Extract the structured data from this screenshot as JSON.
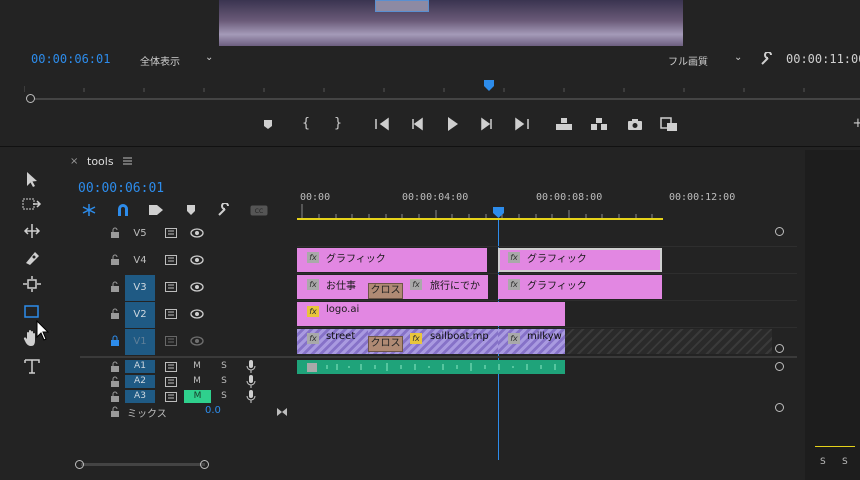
{
  "program_monitor": {
    "current_timecode": "00:00:06:01",
    "zoom_select": "全体表示",
    "quality_select": "フル画質",
    "duration_timecode": "00:00:11:00"
  },
  "timeline": {
    "panel_title": "tools",
    "timecode": "00:00:06:01",
    "ruler": [
      "00:00",
      "00:00:04:00",
      "00:00:08:00",
      "00:00:12:00"
    ],
    "video_tracks": [
      {
        "label": "V5",
        "active": false
      },
      {
        "label": "V4",
        "active": false
      },
      {
        "label": "V3",
        "active": true
      },
      {
        "label": "V2",
        "active": true
      },
      {
        "label": "V1",
        "active": true
      }
    ],
    "audio_tracks": [
      {
        "label": "A1",
        "m": "M",
        "s": "S",
        "m_active": false
      },
      {
        "label": "A2",
        "m": "M",
        "s": "S",
        "m_active": false
      },
      {
        "label": "A3",
        "m": "M",
        "s": "S",
        "m_active": true
      }
    ],
    "mix": {
      "label": "ミックス",
      "value": "0.0"
    },
    "clips": {
      "v4_1": "グラフィック",
      "v4_2": "グラフィック",
      "v3_1": "お仕事",
      "v3_trans": "クロス",
      "v3_2": "旅行にでか",
      "v3_3": "グラフィック",
      "v2_1": "logo.ai",
      "v1_1": "street",
      "v1_trans": "クロス",
      "v1_2": "sailboat.mp",
      "v1_3": "milkyw"
    },
    "fx_label": "fx"
  },
  "right_panel": {
    "s1": "S",
    "s2": "S"
  },
  "colors": {
    "accent_blue": "#2d8ceb",
    "clip_pink": "#e287e2",
    "audio_green": "#1fa37a"
  }
}
